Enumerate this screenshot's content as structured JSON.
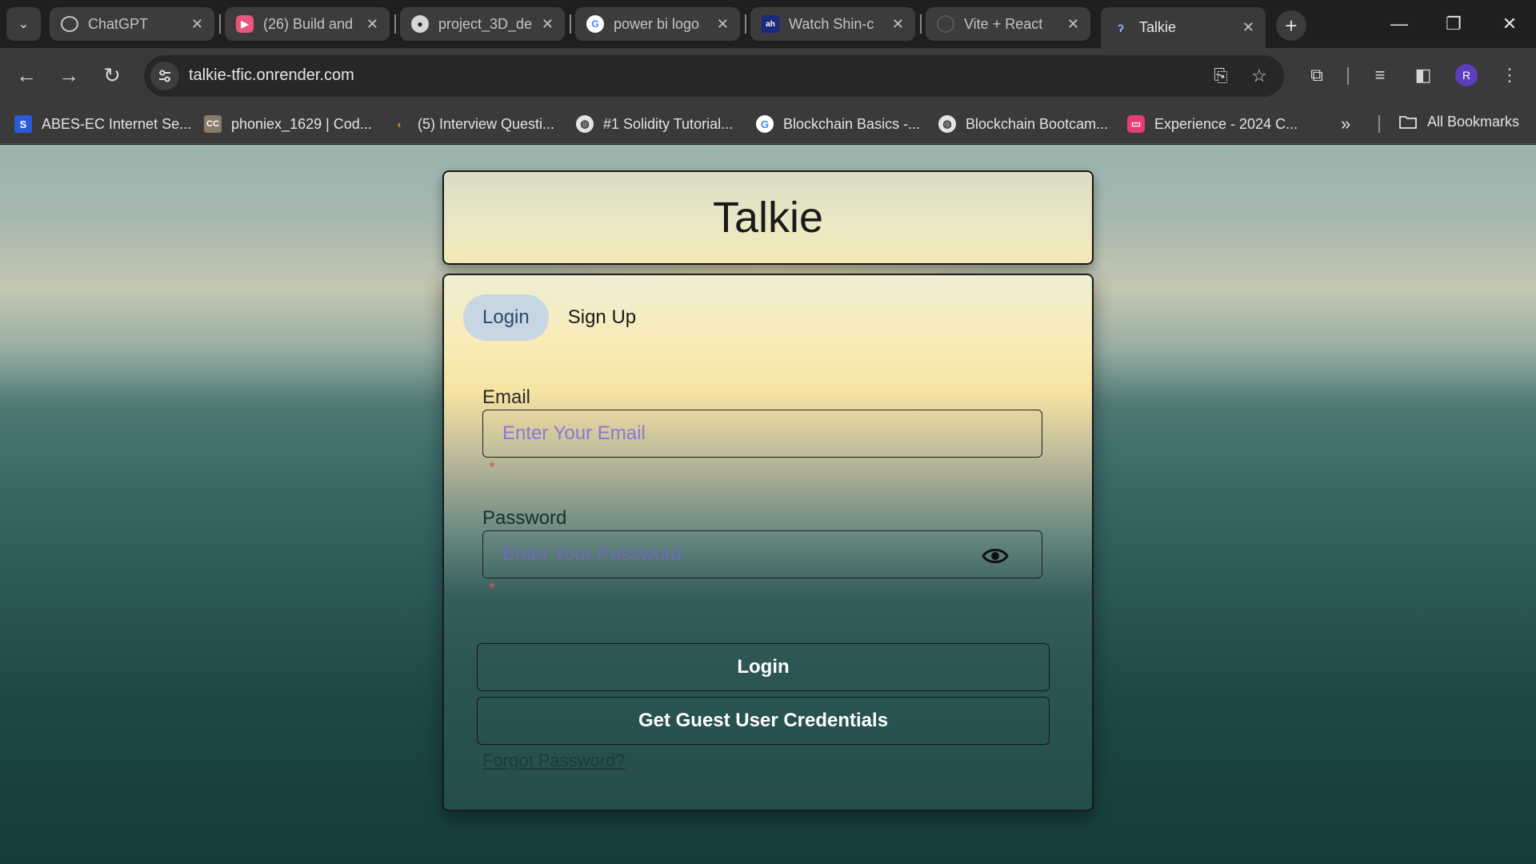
{
  "browser": {
    "tabs": [
      {
        "title": "ChatGPT",
        "icon": "chatgpt-icon"
      },
      {
        "title": "(26) Build and",
        "icon": "youtube-icon"
      },
      {
        "title": "project_3D_de",
        "icon": "github-icon"
      },
      {
        "title": "power bi logo",
        "icon": "google-icon"
      },
      {
        "title": "Watch Shin-c",
        "icon": "streaming-site-icon"
      },
      {
        "title": "Vite + React",
        "icon": "loading-icon"
      },
      {
        "title": "Talkie",
        "icon": "talkie-icon"
      }
    ],
    "active_tab_index": 6,
    "url": "talkie-tfic.onrender.com",
    "profile_initial": "R",
    "bookmarks": [
      {
        "label": "ABES-EC Internet Se...",
        "icon": "s-icon"
      },
      {
        "label": "phoniex_1629 | Cod...",
        "icon": "cc-icon"
      },
      {
        "label": "(5) Interview Questi...",
        "icon": "leetcode-icon"
      },
      {
        "label": "#1 Solidity Tutorial...",
        "icon": "globe-icon"
      },
      {
        "label": "Blockchain Basics -...",
        "icon": "google-icon"
      },
      {
        "label": "Blockchain Bootcam...",
        "icon": "globe-icon"
      },
      {
        "label": "Experience - 2024 C...",
        "icon": "pink-app-icon"
      }
    ],
    "all_bookmarks_label": "All Bookmarks"
  },
  "app": {
    "title": "Talkie",
    "tabs": {
      "login": "Login",
      "signup": "Sign Up"
    },
    "selected_tab": "Login",
    "email": {
      "label": "Email",
      "placeholder": "Enter Your Email",
      "value": ""
    },
    "password": {
      "label": "Password",
      "placeholder": "Enter Your Password",
      "value": ""
    },
    "required_mark": "*",
    "login_button": "Login",
    "guest_button": "Get Guest User Credentials",
    "forgot_link": "Forgot Password?"
  },
  "colors": {
    "selected_tab_bg": "#c6d6e2",
    "placeholder": "#8a77d6",
    "required": "#c85a5a",
    "browser_dark": "#1f1f1f"
  }
}
